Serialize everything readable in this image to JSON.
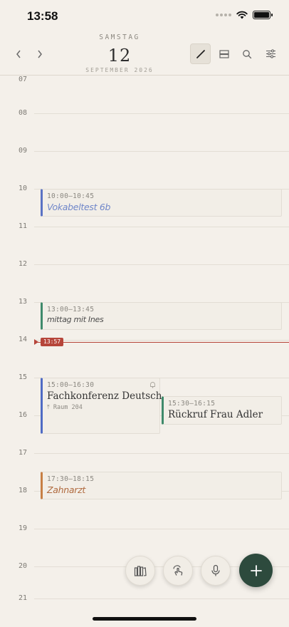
{
  "status_bar": {
    "time": "13:58"
  },
  "header": {
    "weekday": "SAMSTAG",
    "day": "12",
    "month_year": "SEPTEMBER 2026",
    "prev_icon": "chevron-left-icon",
    "next_icon": "chevron-right-icon",
    "tools": [
      "pen-icon",
      "layout-icon",
      "search-icon",
      "sliders-icon"
    ]
  },
  "timeline": {
    "hours": [
      "07",
      "08",
      "09",
      "10",
      "11",
      "12",
      "13",
      "14",
      "15",
      "16",
      "17",
      "18",
      "19",
      "20",
      "21"
    ],
    "now_label": "13:57"
  },
  "events": [
    {
      "time": "10:00–10:45",
      "title": "Vokabeltest 6b",
      "color": "#5a72c4",
      "text_color": "#6f86c9",
      "style": "hand"
    },
    {
      "time": "13:00–13:45",
      "title": "mittag mit Ines",
      "color": "#3f8a6b",
      "text_color": "#4a4a4a",
      "style": "hand"
    },
    {
      "time": "15:00–16:30",
      "title": "Fachkonferenz Deutsch",
      "subtitle": "⤒ Raum 204",
      "color": "#4f6bc4",
      "text_color": "#333333",
      "style": "serif"
    },
    {
      "time": "15:30–16:15",
      "title": "Rückruf Frau Adler",
      "color": "#3f8a6b",
      "text_color": "#333333",
      "style": "serif"
    },
    {
      "time": "17:30–18:15",
      "title": "Zahnarzt",
      "color": "#c77f45",
      "text_color": "#b06a3e",
      "style": "hand"
    }
  ],
  "bottom_actions": [
    "library-icon",
    "tap-icon",
    "microphone-icon",
    "plus-icon"
  ],
  "colors": {
    "accent": "#2d4a3d",
    "now": "#b6453a",
    "background": "#f4f0ea"
  }
}
